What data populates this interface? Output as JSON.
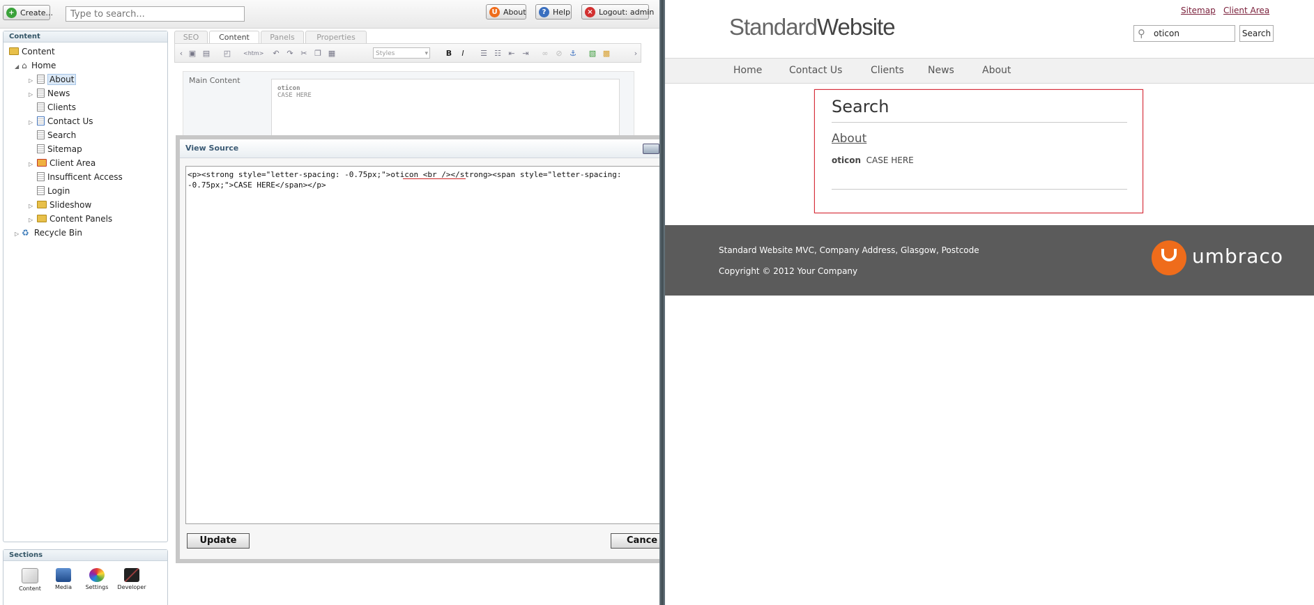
{
  "backoffice": {
    "toolbar": {
      "create_label": "Create...",
      "search_placeholder": "Type to search...",
      "about_label": "About",
      "help_label": "Help",
      "logout_label": "Logout: admin"
    },
    "tree": {
      "header": "Content",
      "items": [
        {
          "label": "Content"
        },
        {
          "label": "Home"
        },
        {
          "label": "About"
        },
        {
          "label": "News"
        },
        {
          "label": "Clients"
        },
        {
          "label": "Contact Us"
        },
        {
          "label": "Search"
        },
        {
          "label": "Sitemap"
        },
        {
          "label": "Client Area"
        },
        {
          "label": "Insufficent Access"
        },
        {
          "label": "Login"
        },
        {
          "label": "Slideshow"
        },
        {
          "label": "Content Panels"
        },
        {
          "label": "Recycle Bin"
        }
      ]
    },
    "sections": {
      "header": "Sections",
      "items": [
        "Content",
        "Media",
        "Settings",
        "Developer"
      ]
    },
    "editor": {
      "tabs": [
        "SEO",
        "Content",
        "Panels",
        "Properties"
      ],
      "styles_label": "Styles",
      "field_label": "Main Content",
      "rte_line1": "oticon",
      "rte_line2": "CASE HERE"
    },
    "view_source": {
      "title": "View Source",
      "source_line1": "<p><strong style=\"letter-spacing: -0.75px;\">oticon <br /></strong><span style=\"letter-spacing:",
      "source_line2": "-0.75px;\">CASE HERE</span></p>",
      "update_label": "Update",
      "cancel_label": "Cance"
    }
  },
  "site": {
    "logo_part1": "Standard",
    "logo_part2": "Website",
    "toplinks": [
      "Sitemap",
      "Client Area"
    ],
    "search_value": "oticon",
    "search_button": "Search",
    "nav": [
      "Home",
      "Contact Us",
      "Clients",
      "News",
      "About"
    ],
    "result": {
      "title": "Search",
      "link": "About",
      "snippet_bold": "oticon",
      "snippet_rest": "CASE HERE"
    },
    "footer": {
      "line1": "Standard Website MVC, Company Address, Glasgow, Postcode",
      "line2": "Copyright © 2012 Your Company",
      "brand": "umbraco"
    },
    "colors": {
      "footer_bg": "#5b5b5b",
      "umbraco_orange": "#ef6c1b",
      "highlight_red": "#d62b38"
    }
  }
}
